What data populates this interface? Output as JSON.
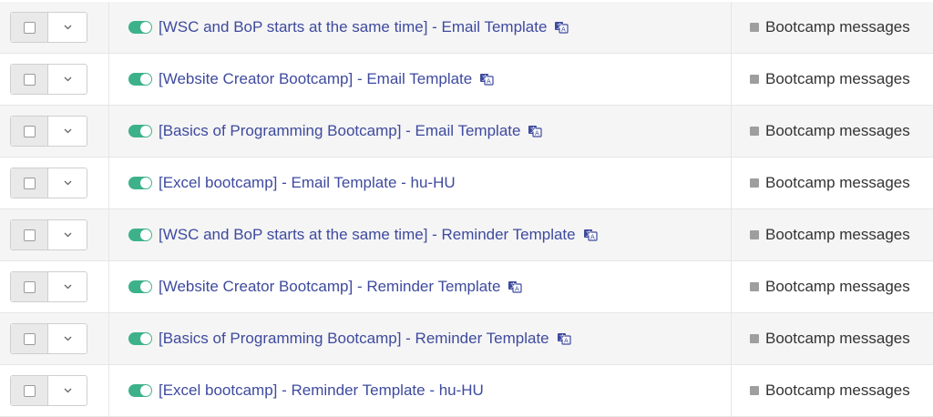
{
  "rows": [
    {
      "name": "[WSC and BoP starts at the same time] - Email Template",
      "category": "Bootcamp messages",
      "active": true,
      "translate_icon": "translate-icon"
    },
    {
      "name": "[Website Creator Bootcamp] - Email Template",
      "category": "Bootcamp messages",
      "active": true,
      "translate_icon": "translate-icon"
    },
    {
      "name": "[Basics of Programming Bootcamp] - Email Template",
      "category": "Bootcamp messages",
      "active": true,
      "translate_icon": "translate-icon"
    },
    {
      "name": "[Excel bootcamp] - Email Template - hu-HU",
      "category": "Bootcamp messages",
      "active": true,
      "translate_icon": ""
    },
    {
      "name": "[WSC and BoP starts at the same time] - Reminder Template",
      "category": "Bootcamp messages",
      "active": true,
      "translate_icon": "translate-icon"
    },
    {
      "name": "[Website Creator Bootcamp] - Reminder Template",
      "category": "Bootcamp messages",
      "active": true,
      "translate_icon": "translate-icon"
    },
    {
      "name": "[Basics of Programming Bootcamp] - Reminder Template",
      "category": "Bootcamp messages",
      "active": true,
      "translate_icon": "translate-icon"
    },
    {
      "name": "[Excel bootcamp] - Reminder Template - hu-HU",
      "category": "Bootcamp messages",
      "active": true,
      "translate_icon": ""
    }
  ],
  "colors": {
    "toggle_on": "#3db28a",
    "link": "#3e4a9e",
    "category_square": "#9e9e9e"
  }
}
